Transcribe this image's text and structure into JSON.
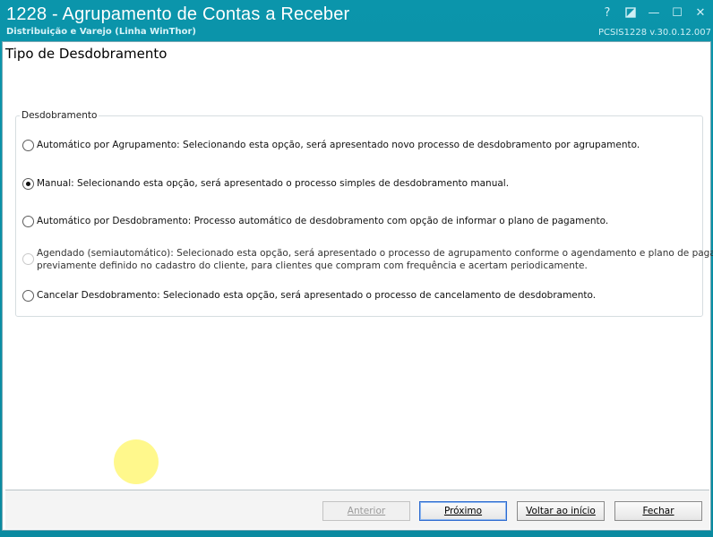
{
  "window": {
    "title": "1228 - Agrupamento de Contas a Receber",
    "subtitle": "Distribuição e Varejo (Linha WinThor)",
    "version": "PCSIS1228  v.30.0.12.007",
    "controls": {
      "help": "?",
      "restore_icon": "restore-icon",
      "minimize": "—",
      "maximize": "☐",
      "close": "✕"
    }
  },
  "page": {
    "title": "Tipo de Desdobramento"
  },
  "group": {
    "legend": "Desdobramento",
    "options": [
      {
        "text": "Automático por Agrupamento: Selecionando esta opção, será apresentado novo processo de desdobramento por agrupamento.",
        "checked": false,
        "enabled": true
      },
      {
        "text": "Manual: Selecionando esta opção, será apresentado o processo simples de desdobramento manual.",
        "checked": true,
        "enabled": true
      },
      {
        "text": "Automático por Desdobramento: Processo automático de desdobramento com opção de informar o plano de pagamento.",
        "checked": false,
        "enabled": true
      },
      {
        "line1": "Agendado (semiautomático): Selecionado esta opção, será apresentado o processo de agrupamento conforme o agendamento e plano de pagamento",
        "line2": "previamente definido no cadastro do cliente, para clientes que compram com frequência e acertam periodicamente.",
        "checked": false,
        "enabled": false
      },
      {
        "text": "Cancelar Desdobramento: Selecionado esta opção, será apresentado o processo de cancelamento de desdobramento.",
        "checked": false,
        "enabled": true
      }
    ]
  },
  "footer": {
    "anterior": "Anterior",
    "proximo": "Próximo",
    "voltar": "Voltar ao início",
    "fechar": "Fechar"
  },
  "colors": {
    "titlebar": "#0b95ab",
    "cursor_highlight": "#fff778"
  }
}
